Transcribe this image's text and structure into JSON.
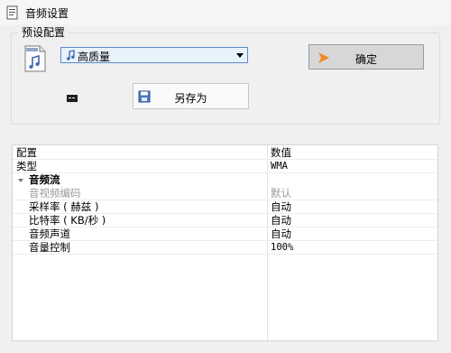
{
  "window": {
    "title": "音频设置",
    "title_icon": "gear-doc-icon"
  },
  "preset": {
    "group_label": "预设配置",
    "selected": "高质量",
    "icon_doc": "wma-file-icon",
    "icon_note": "music-note-icon"
  },
  "buttons": {
    "ok_label": "确定",
    "save_as_label": "另存为"
  },
  "grid": {
    "header": {
      "name": "配置",
      "value": "数值"
    },
    "type_row": {
      "name": "类型",
      "value": "WMA"
    },
    "category": "音频流",
    "rows": [
      {
        "name": "音视频编码",
        "value": "默认"
      },
      {
        "name": "采样率 ( 赫兹 )",
        "value": "自动"
      },
      {
        "name": "比特率 ( KB/秒 )",
        "value": "自动"
      },
      {
        "name": "音频声道",
        "value": "自动"
      },
      {
        "name": "音量控制",
        "value": "100%"
      }
    ]
  },
  "colors": {
    "window_bg": "#f0f0f0",
    "select_bg": "#e8f2fb",
    "select_border": "#5a8bc8",
    "ok_arrow": "#f08a24"
  }
}
